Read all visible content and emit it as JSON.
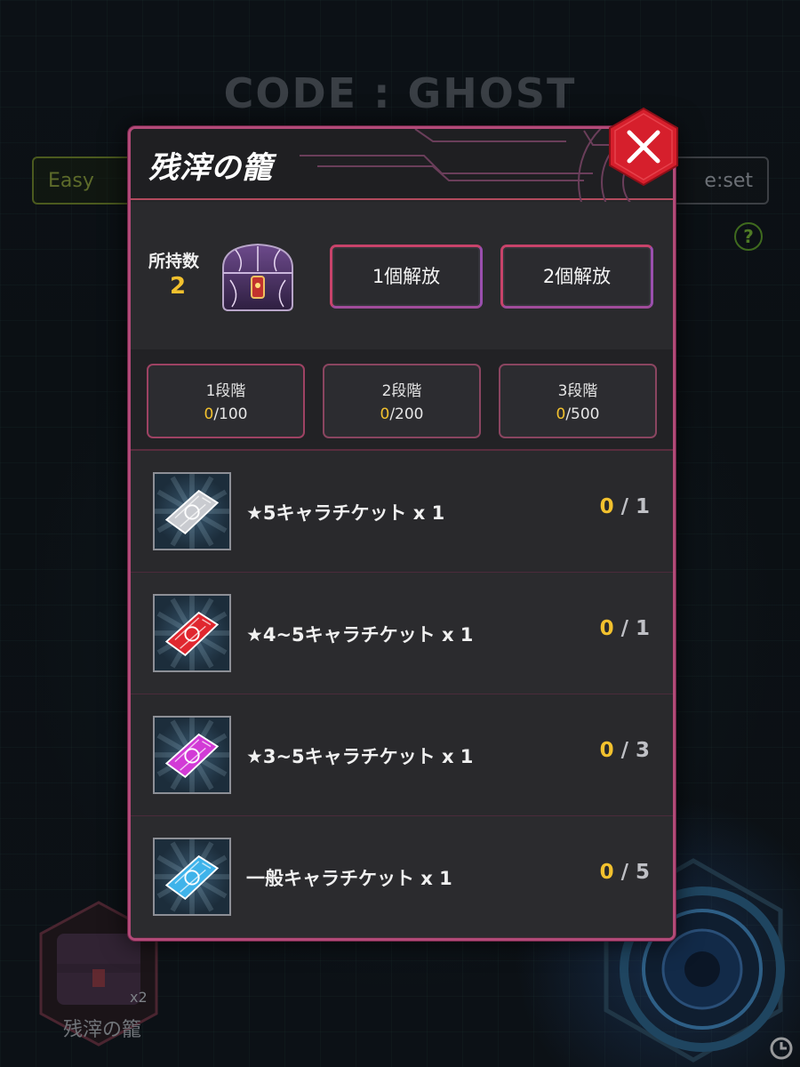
{
  "background": {
    "title": "CODE : GHOST",
    "left_pill": "Easy",
    "right_pill": "e:set",
    "help_icon": "?",
    "cage_label": "残滓の籠",
    "cage_count": "x2"
  },
  "dialog": {
    "title": "残滓の籠",
    "close_icon": "close-icon",
    "owned": {
      "label": "所持数",
      "count": "2"
    },
    "buttons": {
      "release_one": "1個解放",
      "release_two": "2個解放"
    },
    "stages": [
      {
        "name": "1段階",
        "current": "0",
        "total": "/100"
      },
      {
        "name": "2段階",
        "current": "0",
        "total": "/200"
      },
      {
        "name": "3段階",
        "current": "0",
        "total": "/500"
      }
    ],
    "rewards": [
      {
        "name": "★5キャラチケット x 1",
        "current": "0",
        "total": "/ 1",
        "ticket_color": "#c9cbd0"
      },
      {
        "name": "★4~5キャラチケット x 1",
        "current": "0",
        "total": "/ 1",
        "ticket_color": "#e0272f"
      },
      {
        "name": "★3~5キャラチケット x 1",
        "current": "0",
        "total": "/ 3",
        "ticket_color": "#d23ad6"
      },
      {
        "name": "一般キャラチケット x 1",
        "current": "0",
        "total": "/ 5",
        "ticket_color": "#3fb3ea"
      }
    ]
  },
  "colors": {
    "accent_yellow": "#f2c12e",
    "frame_pink": "#b24a78",
    "close_red": "#d61f2c"
  }
}
